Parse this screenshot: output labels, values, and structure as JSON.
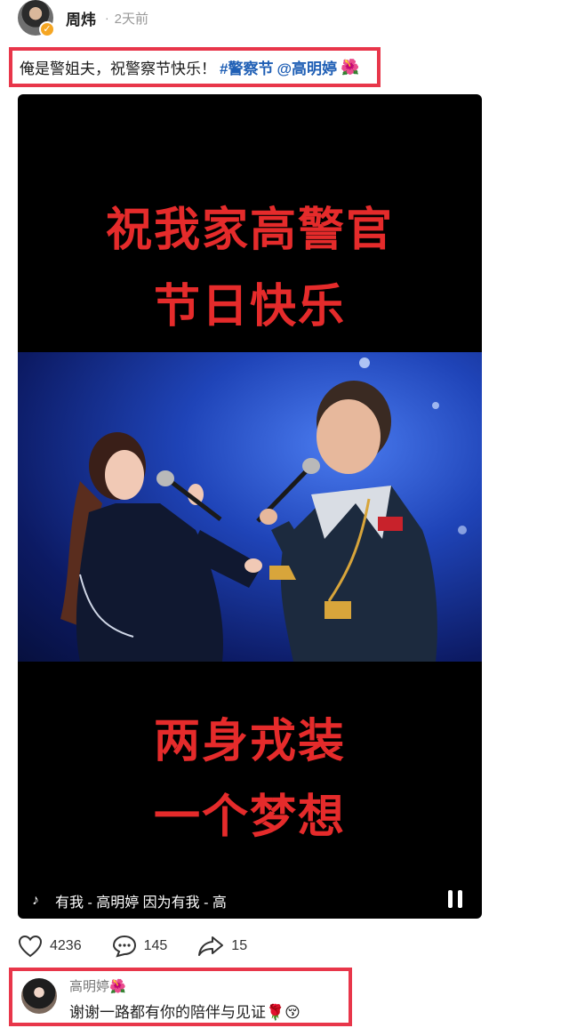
{
  "post": {
    "author": "周炜",
    "separator": "·",
    "time": "2天前",
    "text": "俺是警姐夫，祝警察节快乐！",
    "hashtag": "#警察节",
    "mention": "@高明婷",
    "emoji": "🌺"
  },
  "video": {
    "caption_line1": "祝我家高警官",
    "caption_line2": "节日快乐",
    "caption_line3": "两身戎装",
    "caption_line4": "一个梦想",
    "music_icon": "♪",
    "music_text": "有我 - 高明婷    因为有我 - 高"
  },
  "actions": {
    "likes": "4236",
    "comments": "145",
    "shares": "15"
  },
  "comment": {
    "author": "高明婷",
    "author_emoji": "🌺",
    "text": "谢谢一路都有你的陪伴与见证",
    "text_emoji": "🌹😚"
  },
  "colors": {
    "highlight_border": "#e8364a",
    "link": "#1f5fb5",
    "caption_red": "#e52b2b"
  }
}
